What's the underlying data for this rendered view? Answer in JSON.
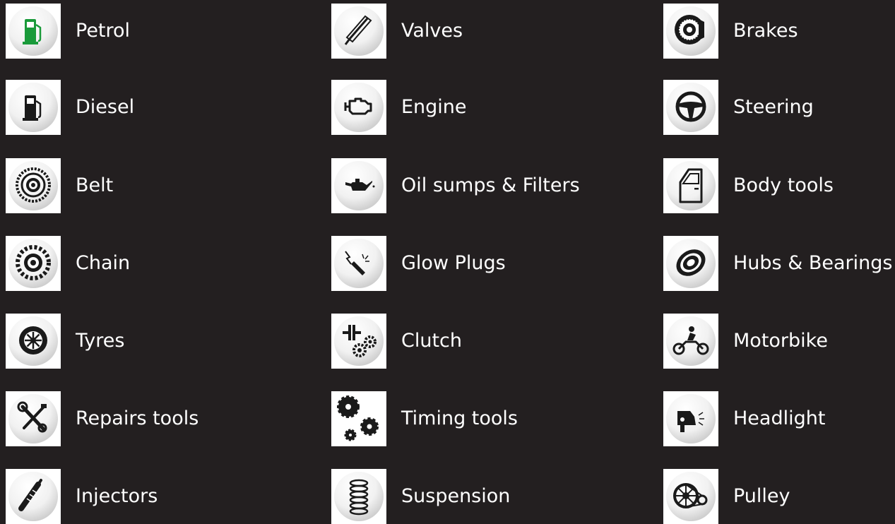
{
  "colors": {
    "background": "#231f20",
    "label": "#ffffff",
    "tile": "#ffffff",
    "icon": "#1a1a1a",
    "petrol_accent": "#1a9a3a"
  },
  "categories": [
    {
      "label": "Petrol",
      "icon": "petrol-pump-icon"
    },
    {
      "label": "Diesel",
      "icon": "diesel-pump-icon"
    },
    {
      "label": "Belt",
      "icon": "timing-belt-icon"
    },
    {
      "label": "Chain",
      "icon": "timing-chain-icon"
    },
    {
      "label": "Tyres",
      "icon": "tyre-wheel-icon"
    },
    {
      "label": "Repairs tools",
      "icon": "wrench-caliper-icon"
    },
    {
      "label": "Injectors",
      "icon": "injector-icon"
    },
    {
      "label": "Valves",
      "icon": "valve-icon"
    },
    {
      "label": "Engine",
      "icon": "engine-icon"
    },
    {
      "label": "Oil sumps & Filters",
      "icon": "oil-can-icon"
    },
    {
      "label": "Glow Plugs",
      "icon": "glow-plug-icon"
    },
    {
      "label": "Clutch",
      "icon": "clutch-gears-icon"
    },
    {
      "label": "Timing tools",
      "icon": "timing-gears-icon"
    },
    {
      "label": "Suspension",
      "icon": "coil-spring-icon"
    },
    {
      "label": "Brakes",
      "icon": "brake-disc-icon"
    },
    {
      "label": "Steering",
      "icon": "steering-wheel-icon"
    },
    {
      "label": "Body tools",
      "icon": "car-door-icon"
    },
    {
      "label": "Hubs & Bearings",
      "icon": "wheel-bearing-icon"
    },
    {
      "label": "Motorbike",
      "icon": "motorbike-icon"
    },
    {
      "label": "Headlight",
      "icon": "headlight-icon"
    },
    {
      "label": "Pulley",
      "icon": "pulley-icon"
    }
  ]
}
